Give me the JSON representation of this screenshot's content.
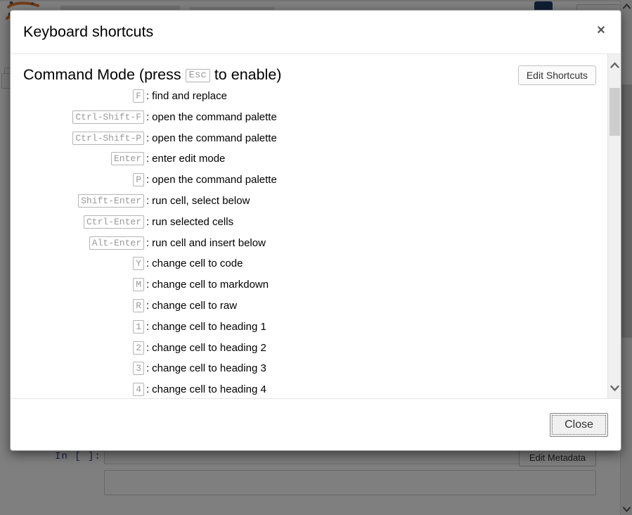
{
  "background": {
    "app": "Jupyter Notebook",
    "cell_prompt": "In [ ]:",
    "edit_metadata_label": "Edit Metadata",
    "logo_color": "#e8762c",
    "badge_color": "#1e3f66",
    "overlay_color": "rgba(0,0,0,0.5)",
    "scrollbar": {
      "up_arrow_icon": "chevron-up-icon",
      "down_arrow_icon": "chevron-down-icon"
    }
  },
  "modal": {
    "title": "Keyboard shortcuts",
    "close_x_label": "×",
    "close_x_icon": "close-icon",
    "section": {
      "title_prefix": "Command Mode (press",
      "title_key": "Esc",
      "title_suffix": "to enable)",
      "edit_shortcuts_label": "Edit Shortcuts"
    },
    "shortcuts": [
      {
        "keys": [
          "F"
        ],
        "separator": ":",
        "description": "find and replace"
      },
      {
        "keys": [
          "Ctrl-Shift-F"
        ],
        "separator": ":",
        "description": "open the command palette"
      },
      {
        "keys": [
          "Ctrl-Shift-P"
        ],
        "separator": ":",
        "description": "open the command palette"
      },
      {
        "keys": [
          "Enter"
        ],
        "separator": ":",
        "description": "enter edit mode"
      },
      {
        "keys": [
          "P"
        ],
        "separator": ":",
        "description": "open the command palette"
      },
      {
        "keys": [
          "Shift-Enter"
        ],
        "separator": ":",
        "description": "run cell, select below"
      },
      {
        "keys": [
          "Ctrl-Enter"
        ],
        "separator": ":",
        "description": "run selected cells"
      },
      {
        "keys": [
          "Alt-Enter"
        ],
        "separator": ":",
        "description": "run cell and insert below"
      },
      {
        "keys": [
          "Y"
        ],
        "separator": ":",
        "description": "change cell to code"
      },
      {
        "keys": [
          "M"
        ],
        "separator": ":",
        "description": "change cell to markdown"
      },
      {
        "keys": [
          "R"
        ],
        "separator": ":",
        "description": "change cell to raw"
      },
      {
        "keys": [
          "1"
        ],
        "separator": ":",
        "description": "change cell to heading 1"
      },
      {
        "keys": [
          "2"
        ],
        "separator": ":",
        "description": "change cell to heading 2"
      },
      {
        "keys": [
          "3"
        ],
        "separator": ":",
        "description": "change cell to heading 3"
      },
      {
        "keys": [
          "4"
        ],
        "separator": ":",
        "description": "change cell to heading 4"
      }
    ],
    "scrollbar": {
      "up_arrow_icon": "chevron-up-icon",
      "down_arrow_icon": "chevron-down-icon",
      "thumb_name": "scrollbar-thumb"
    },
    "footer": {
      "close_label": "Close"
    }
  }
}
